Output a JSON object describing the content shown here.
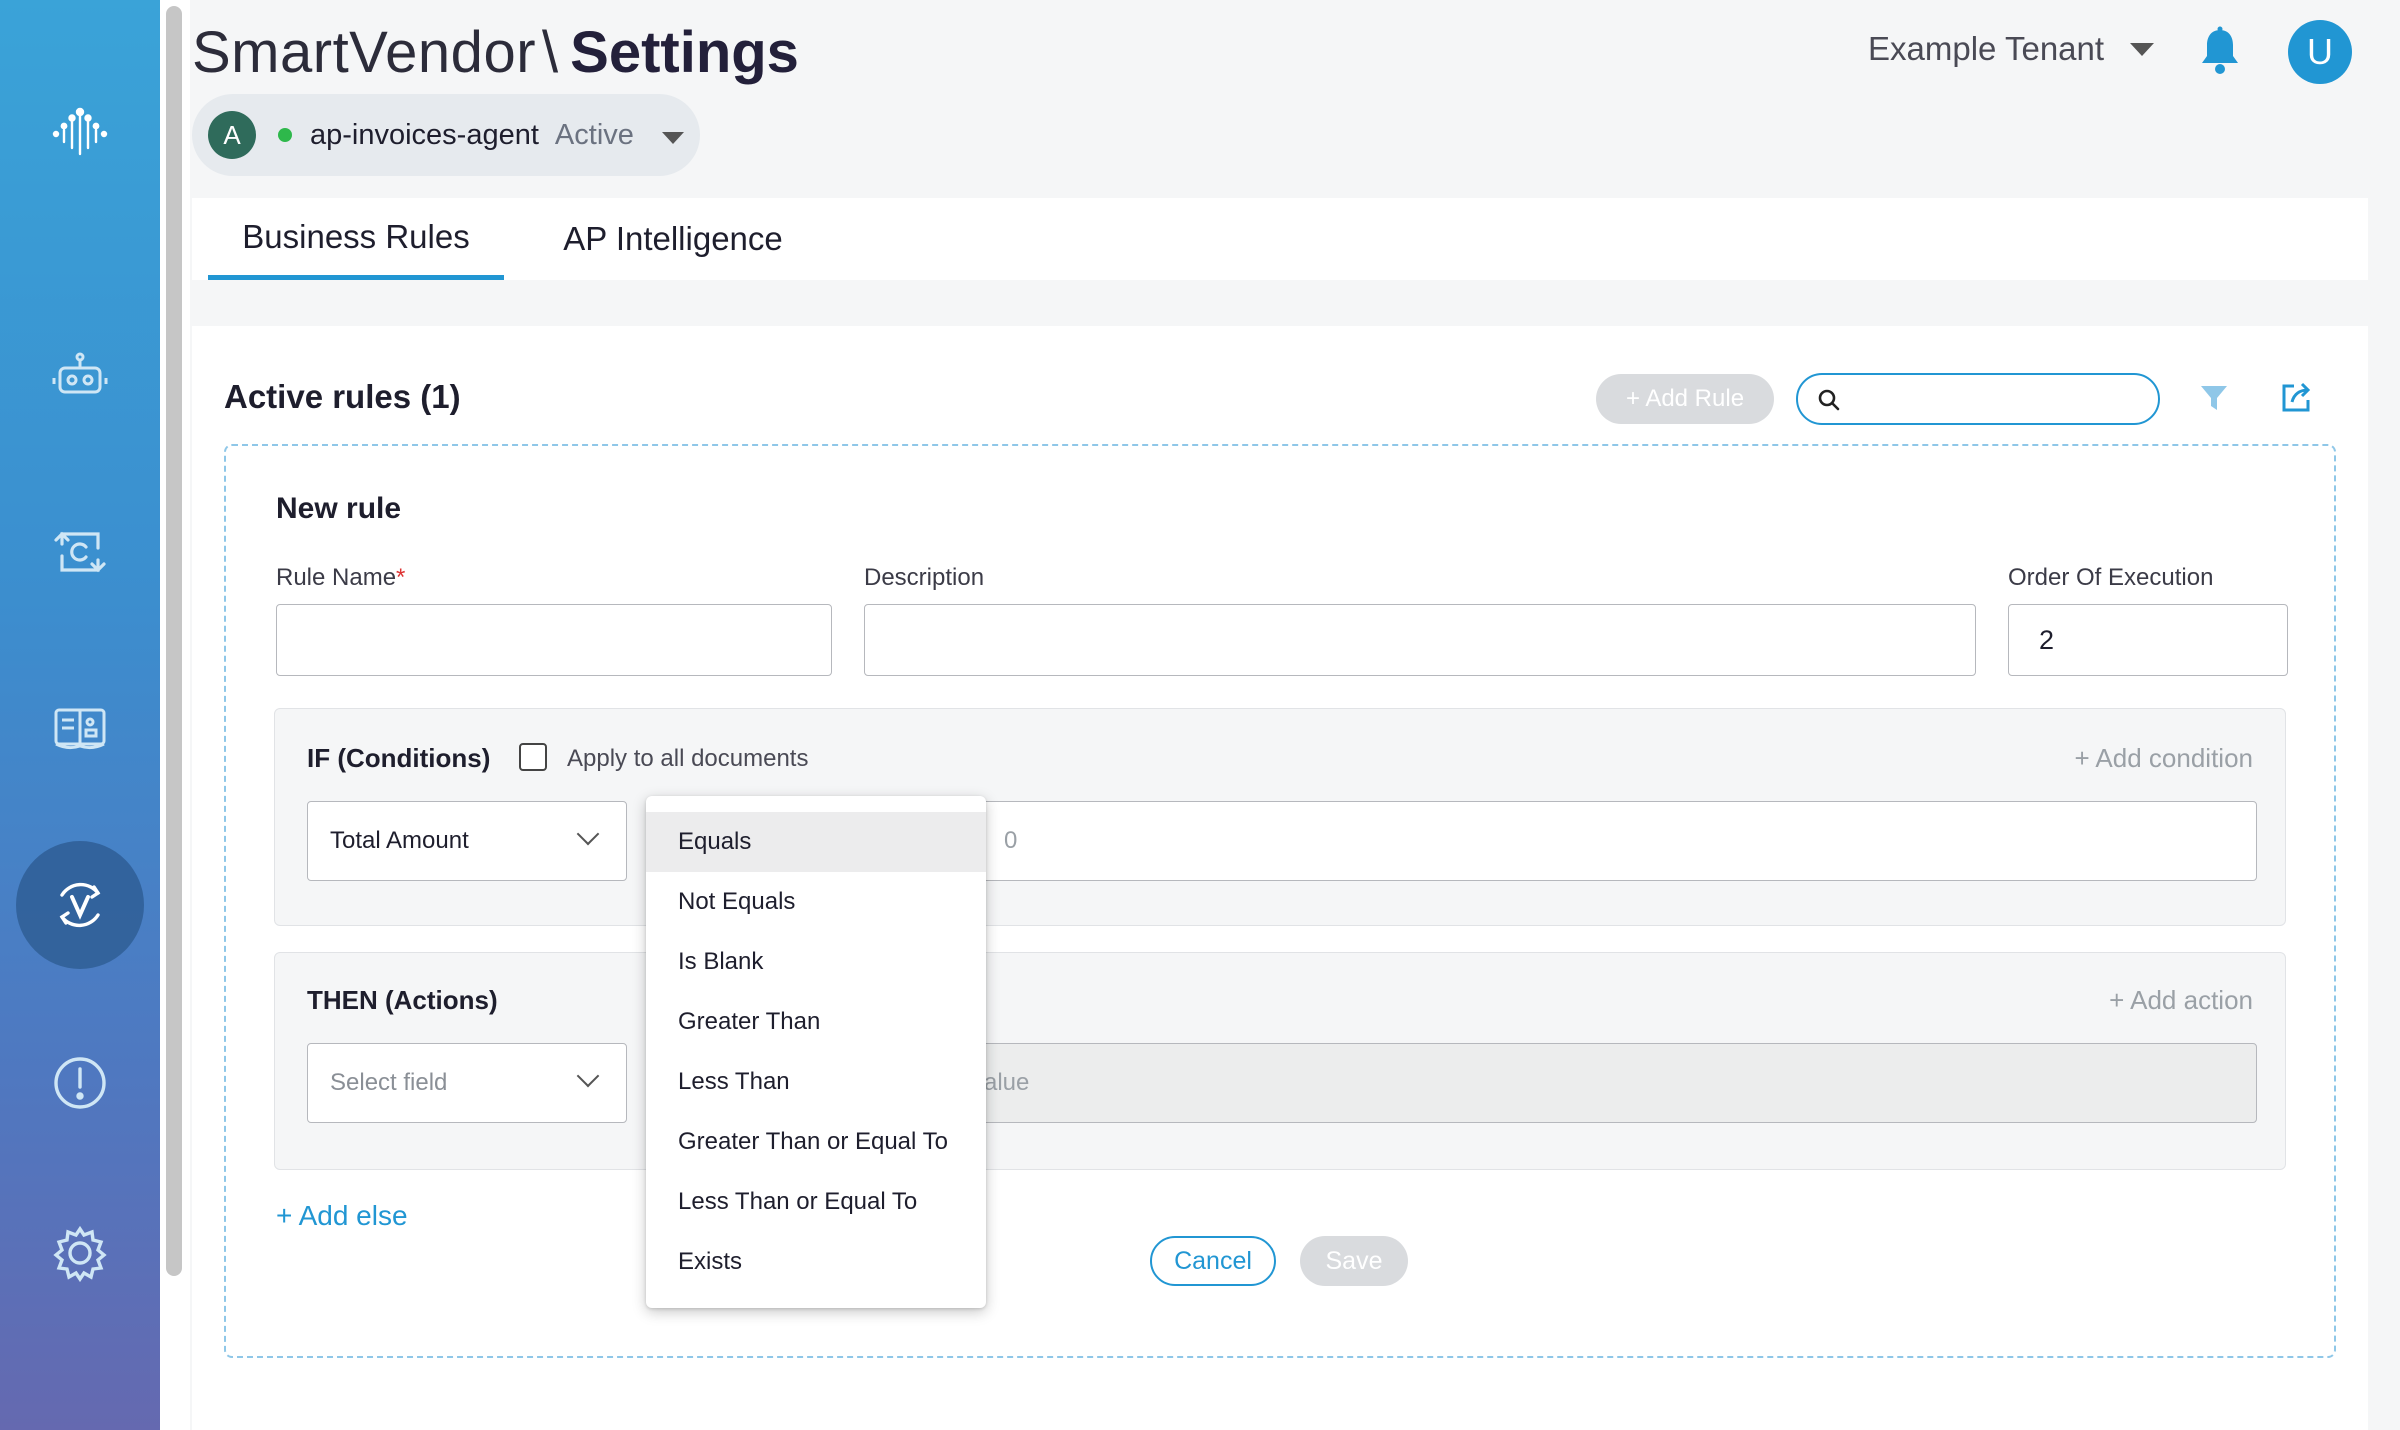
{
  "app": {
    "name": "SmartVendor",
    "separator": "\\",
    "page": "Settings"
  },
  "agent": {
    "initial": "A",
    "name": "ap-invoices-agent",
    "status": "Active"
  },
  "header": {
    "tenant": "Example Tenant",
    "user_initial": "U"
  },
  "sidebar": {
    "items": [
      {
        "name": "logo-icon"
      },
      {
        "name": "robot-icon"
      },
      {
        "name": "sync-c-icon"
      },
      {
        "name": "dashboard-book-icon"
      },
      {
        "name": "vendor-v-icon"
      },
      {
        "name": "alert-icon"
      },
      {
        "name": "gear-icon"
      }
    ]
  },
  "tabs": [
    {
      "label": "Business Rules",
      "active": true
    },
    {
      "label": "AP Intelligence",
      "active": false
    }
  ],
  "rules": {
    "section_title": "Active rules (1)",
    "add_rule_label": "+ Add Rule",
    "search_placeholder": "",
    "new_rule": {
      "title": "New rule",
      "rule_name_label": "Rule Name",
      "required_mark": "*",
      "rule_name_value": "",
      "description_label": "Description",
      "description_value": "",
      "order_label": "Order Of Execution",
      "order_value": "2",
      "conditions": {
        "title": "IF (Conditions)",
        "apply_all_label": "Apply to all documents",
        "add_label": "+ Add condition",
        "field_value": "Total Amount",
        "value_hint": "0"
      },
      "actions": {
        "title": "THEN (Actions)",
        "add_label": "+ Add action",
        "field_placeholder": "Select field",
        "value_hint": "alue"
      },
      "add_else_label": "+ Add else",
      "cancel_label": "Cancel",
      "save_label": "Save"
    }
  },
  "operator_dropdown": {
    "hovered": "Equals",
    "options": [
      "Equals",
      "Not Equals",
      "Is Blank",
      "Greater Than",
      "Less Than",
      "Greater Than or Equal To",
      "Less Than or Equal To",
      "Exists"
    ]
  },
  "colors": {
    "accent": "#2196d3",
    "sidebar_top": "#3aa3d8",
    "sidebar_bottom": "#6569b0",
    "active_dot": "#2eb84b"
  }
}
